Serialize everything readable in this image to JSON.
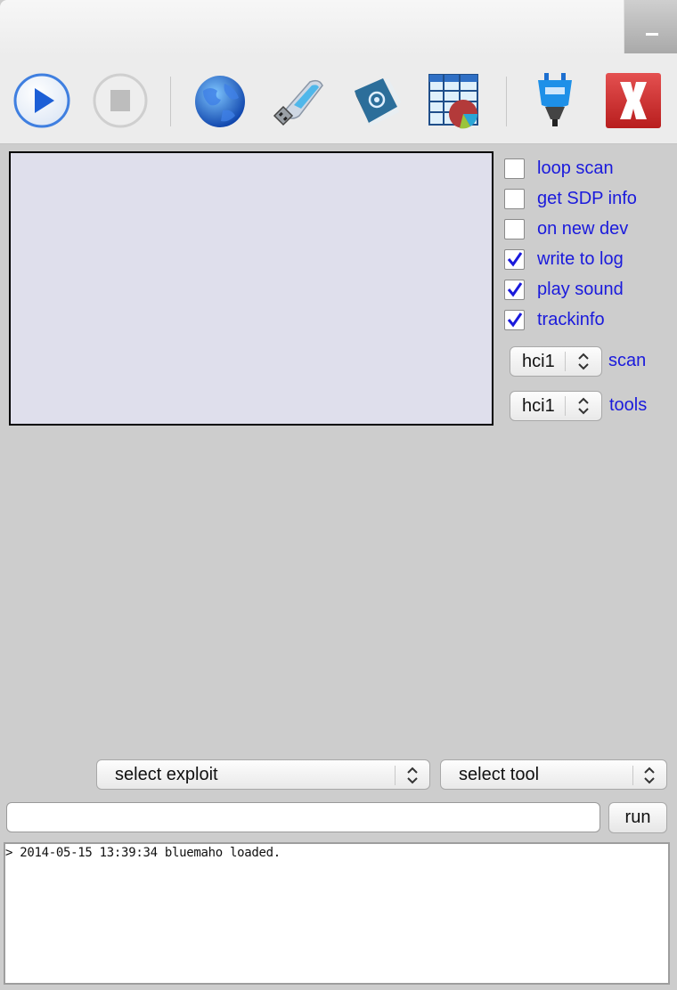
{
  "window": {
    "title": "",
    "minimize_icon": "minimize-icon"
  },
  "toolbar": {
    "buttons": [
      {
        "name": "start-scan-button",
        "icon": "play-icon",
        "enabled": true
      },
      {
        "name": "stop-scan-button",
        "icon": "stop-icon",
        "enabled": false
      },
      {
        "name": "network-button",
        "icon": "globe-icon",
        "enabled": true
      },
      {
        "name": "usb-button",
        "icon": "usb-drive-icon",
        "enabled": true
      },
      {
        "name": "address-book-button",
        "icon": "address-book-icon",
        "enabled": true
      },
      {
        "name": "statistics-button",
        "icon": "spreadsheet-chart-icon",
        "enabled": true
      },
      {
        "name": "bluetooth-device-button",
        "icon": "bluetooth-dongle-icon",
        "enabled": true
      },
      {
        "name": "exit-button",
        "icon": "red-x-icon",
        "enabled": true
      }
    ]
  },
  "device_list": {
    "items": []
  },
  "options": [
    {
      "label": "loop scan",
      "checked": false
    },
    {
      "label": "get SDP info",
      "checked": false
    },
    {
      "label": "on new dev",
      "checked": false
    },
    {
      "label": "write to log",
      "checked": true
    },
    {
      "label": "play sound",
      "checked": true
    },
    {
      "label": "trackinfo",
      "checked": true
    }
  ],
  "adapters": {
    "scan": {
      "value": "hci1",
      "label": "scan"
    },
    "tools": {
      "value": "hci1",
      "label": "tools"
    }
  },
  "exploit_select": {
    "value": "select exploit"
  },
  "tool_select": {
    "value": "select tool"
  },
  "command": {
    "value": "",
    "placeholder": ""
  },
  "run_label": "run",
  "log": {
    "lines": [
      "> 2014-05-15 13:39:34 bluemaho loaded."
    ]
  },
  "colors": {
    "option_text": "#1a1adc",
    "device_list_bg": "#dfdfec",
    "window_bg": "#cdcdcd"
  }
}
